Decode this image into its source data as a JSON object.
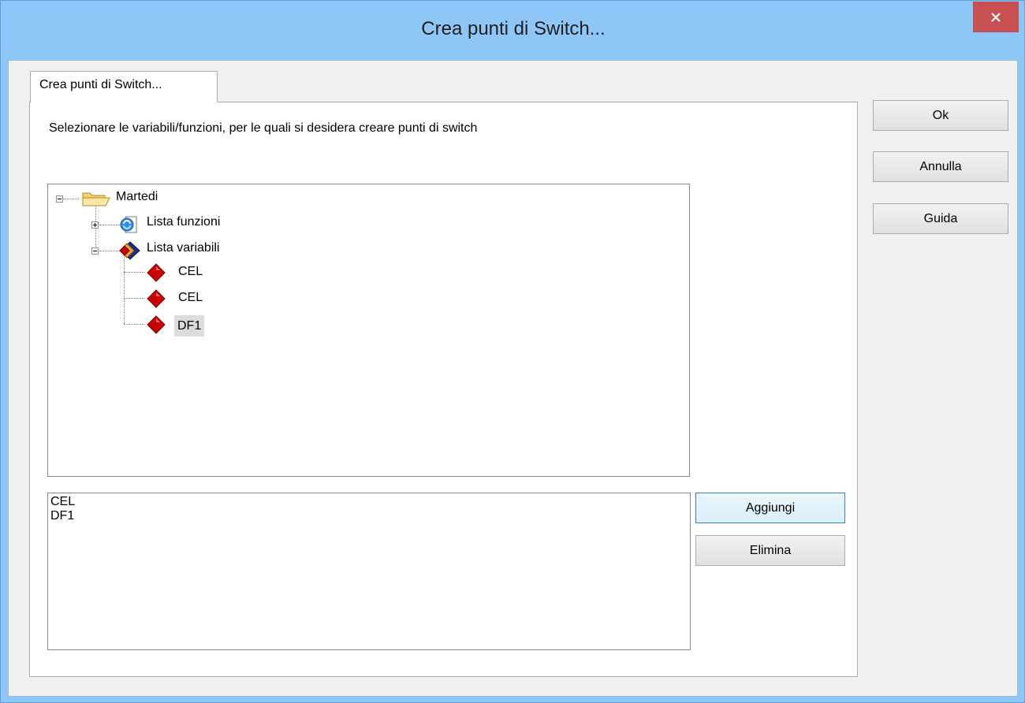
{
  "window": {
    "title": "Crea punti di Switch...",
    "close_icon": "close-icon"
  },
  "tab": {
    "label": "Crea punti di Switch..."
  },
  "instruction": "Selezionare le variabili/funzioni, per le quali si desidera creare punti di switch",
  "tree": {
    "root": {
      "label": "Martedi",
      "icon": "folder-icon",
      "expanded": true
    },
    "groups": [
      {
        "label": "Lista funzioni",
        "icon": "function-list-icon",
        "expanded": false
      },
      {
        "label": "Lista variabili",
        "icon": "variable-list-icon",
        "expanded": true
      }
    ],
    "variables": [
      {
        "label": "CEL",
        "icon": "variable-diamond-icon"
      },
      {
        "label": "CEL",
        "icon": "variable-diamond-icon"
      },
      {
        "label": "DF1",
        "icon": "variable-diamond-icon",
        "selected": true
      }
    ]
  },
  "selected_list": {
    "items": [
      "CEL",
      "DF1"
    ]
  },
  "buttons": {
    "ok": "Ok",
    "annulla": "Annulla",
    "guida": "Guida",
    "aggiungi": "Aggiungi",
    "elimina": "Elimina"
  },
  "colors": {
    "title_bar": "#8dc6f7",
    "close_button": "#c75050",
    "diamond_red": "#cc0000",
    "selection": "#dcdcdc"
  }
}
